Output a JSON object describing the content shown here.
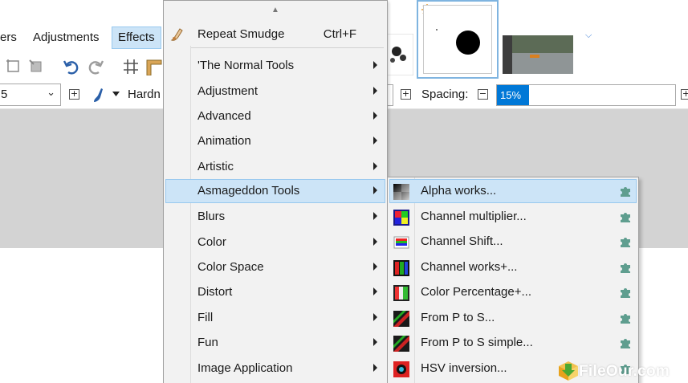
{
  "menubar": {
    "layers_partial": "ers",
    "adjustments": "Adjustments",
    "effects": "Effects"
  },
  "toolbar": {
    "size_value": "5",
    "hardness_label": "Hardn",
    "spacing_label": "Spacing:",
    "spacing_value": "15%"
  },
  "effects_menu": {
    "repeat": {
      "label": "Repeat Smudge",
      "shortcut": "Ctrl+F"
    },
    "items": [
      {
        "label": "'The Normal Tools",
        "has_submenu": true
      },
      {
        "label": "Adjustment",
        "has_submenu": true
      },
      {
        "label": "Advanced",
        "has_submenu": true
      },
      {
        "label": "Animation",
        "has_submenu": true
      },
      {
        "label": "Artistic",
        "has_submenu": true
      },
      {
        "label": "Asmageddon Tools",
        "has_submenu": true,
        "highlighted": true
      },
      {
        "label": "Blurs",
        "has_submenu": true
      },
      {
        "label": "Color",
        "has_submenu": true
      },
      {
        "label": "Color Space",
        "has_submenu": true
      },
      {
        "label": "Distort",
        "has_submenu": true
      },
      {
        "label": "Fill",
        "has_submenu": true
      },
      {
        "label": "Fun",
        "has_submenu": true
      },
      {
        "label": "Image Application",
        "has_submenu": true
      }
    ]
  },
  "submenu": {
    "items": [
      {
        "label": "Alpha works...",
        "icon": "alpha-works-icon",
        "highlighted": true
      },
      {
        "label": "Channel multiplier...",
        "icon": "channel-multiplier-icon"
      },
      {
        "label": "Channel Shift...",
        "icon": "channel-shift-icon"
      },
      {
        "label": "Channel works+...",
        "icon": "channel-works-icon"
      },
      {
        "label": "Color Percentage+...",
        "icon": "color-percentage-icon"
      },
      {
        "label": "From P to S...",
        "icon": "from-p-to-s-icon"
      },
      {
        "label": "From P to S simple...",
        "icon": "from-p-to-s-simple-icon"
      },
      {
        "label": "HSV inversion...",
        "icon": "hsv-inversion-icon"
      }
    ]
  },
  "watermark": {
    "text": "FileOur.com"
  },
  "colors": {
    "highlight_bg": "#cce4f7",
    "highlight_border": "#99c9ef",
    "menu_bg": "#f2f2f2",
    "selection_blue": "#0078d7",
    "canvas_gray": "#d3d3d3",
    "plugin_green": "#5f9e8f"
  }
}
